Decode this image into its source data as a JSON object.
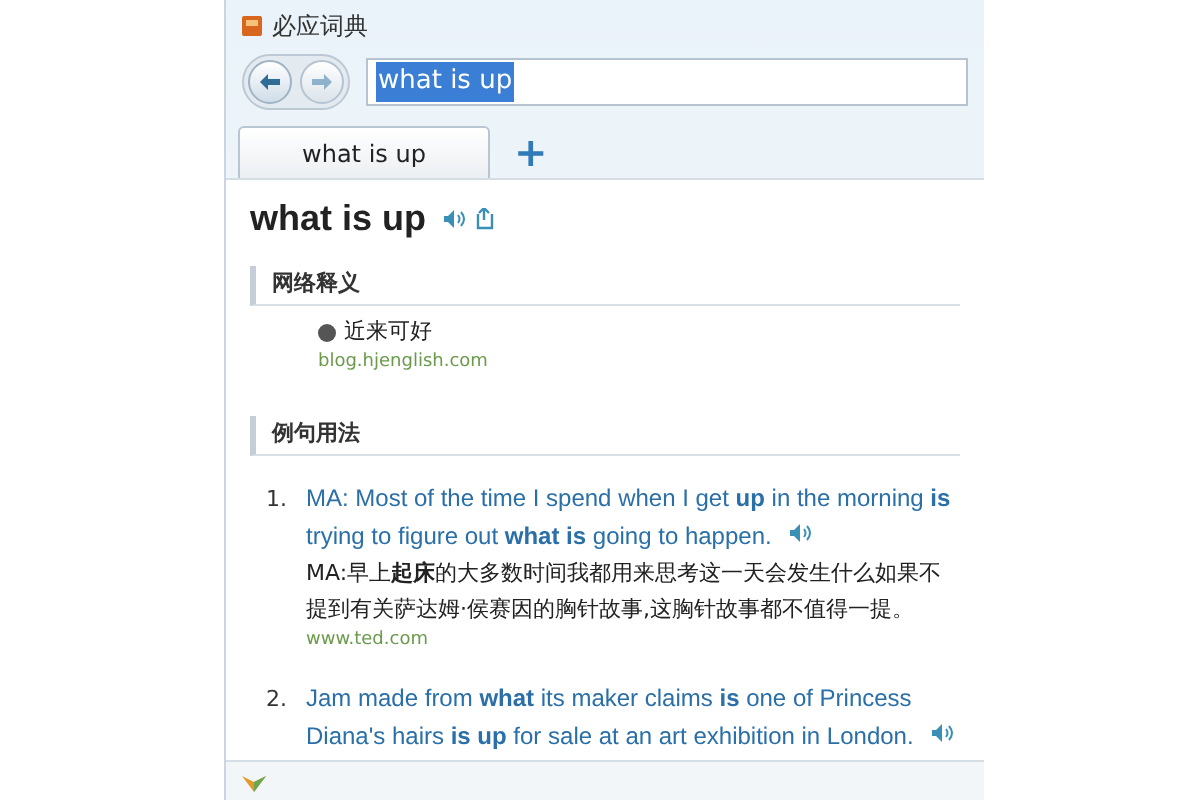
{
  "window": {
    "title": "必应词典"
  },
  "search": {
    "value": "what is up",
    "selected": true
  },
  "tabs": [
    {
      "label": "what is up",
      "selected": true
    }
  ],
  "new_tab": "+",
  "headword": "what is up",
  "sections": [
    {
      "title": "网络释义",
      "kind": "definitions",
      "items": [
        {
          "text": "近来可好",
          "source": "blog.hjenglish.com"
        }
      ]
    },
    {
      "title": "例句用法",
      "kind": "examples",
      "items": [
        {
          "number": "1.",
          "english": "MA: Most of the time I spend when I get **up** in the morning **is** trying to figure out **what is** going to happen.",
          "chinese": "MA:早上**起床**的大多数时间我都用来思考这一天会发生什么如果不提到有关萨达姆·侯赛因的胸针故事,这胸针故事都不值得一提。",
          "source": "www.ted.com"
        },
        {
          "number": "2.",
          "english": "Jam made from **what** its maker claims **is** one of Princess Diana's hairs **is up** for sale at an art exhibition in London."
        }
      ]
    }
  ]
}
